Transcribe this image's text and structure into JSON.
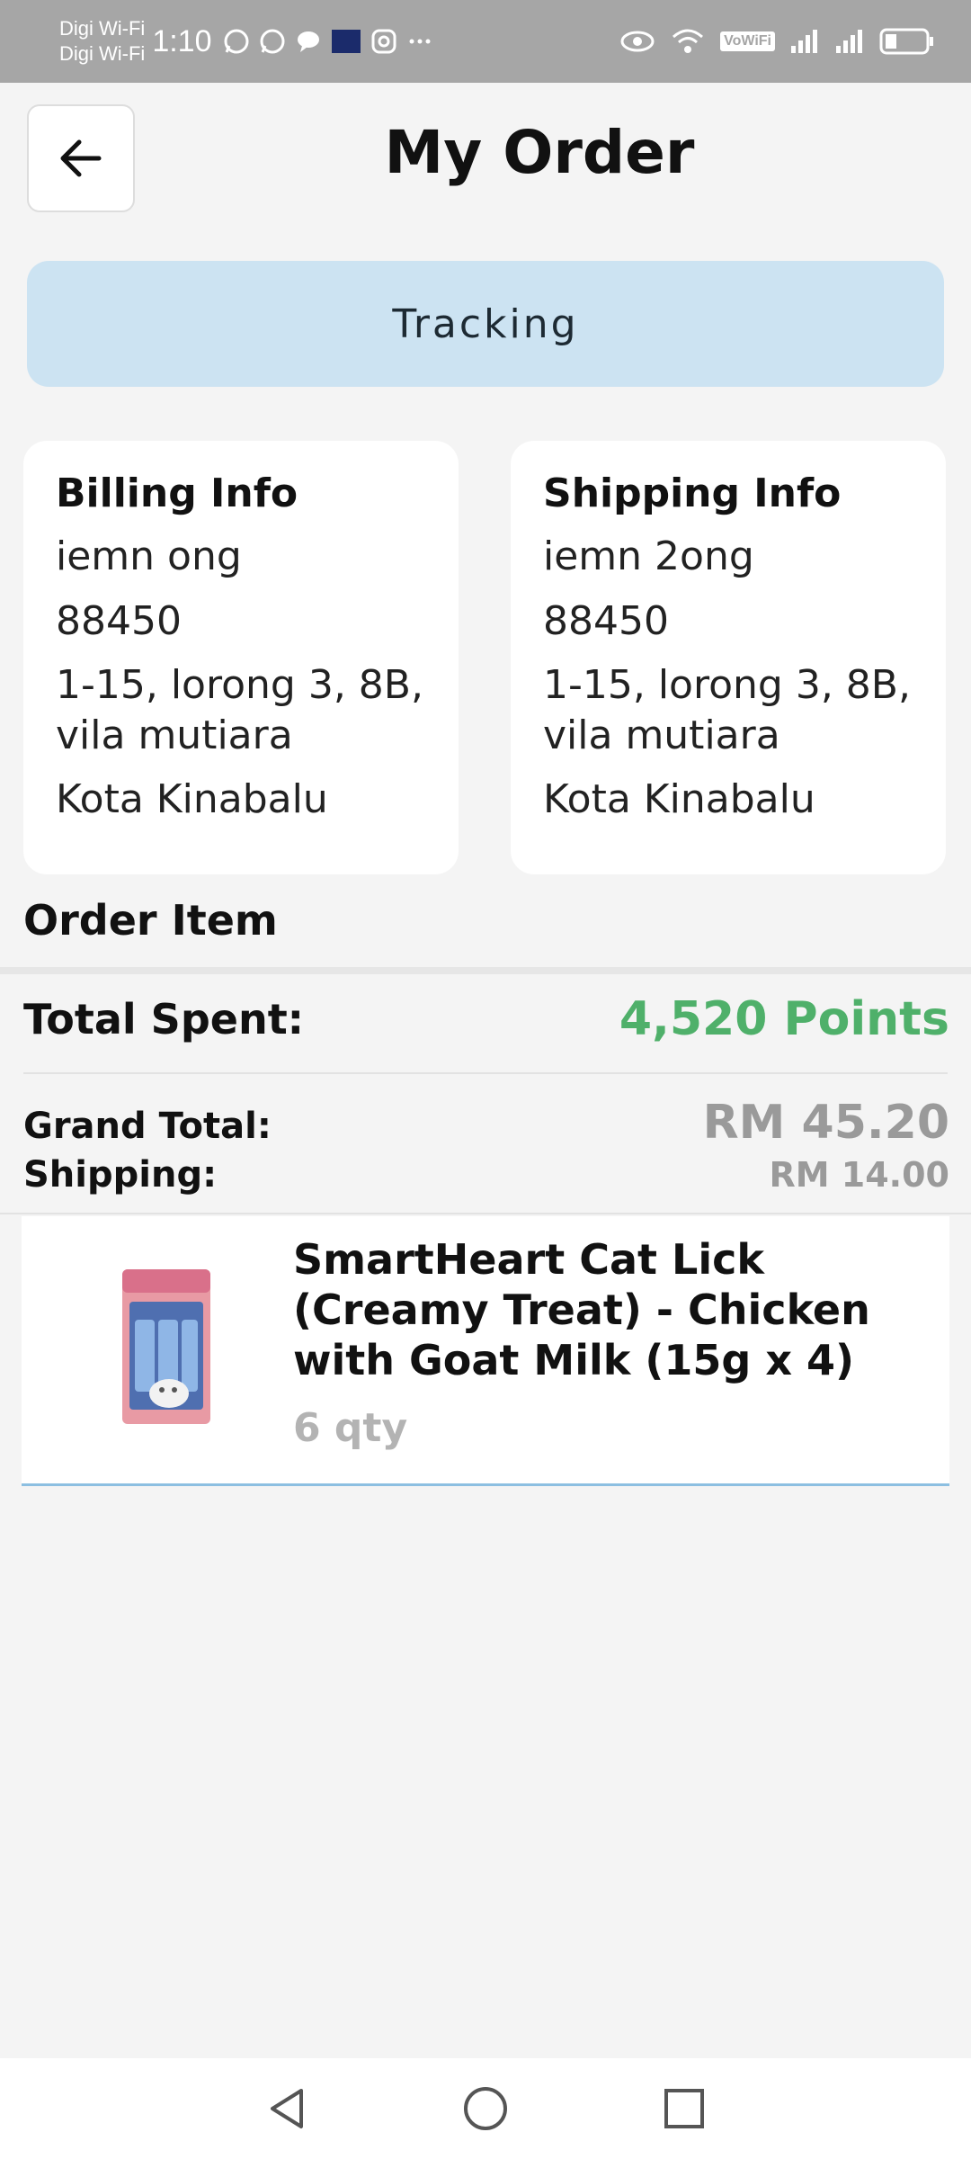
{
  "status_bar": {
    "carrier_1": "Digi Wi-Fi",
    "carrier_2": "Digi Wi-Fi",
    "time": "1:10",
    "vowifi": "VoWiFi"
  },
  "header": {
    "title": "My Order"
  },
  "tracking": {
    "label": "Tracking"
  },
  "billing": {
    "title": "Billing Info",
    "name": "iemn ong",
    "postcode": "88450",
    "address": "1-15, lorong 3, 8B, vila mutiara",
    "city": "Kota Kinabalu"
  },
  "shipping": {
    "title": "Shipping Info",
    "name": "iemn 2ong",
    "postcode": "88450",
    "address": "1-15, lorong 3, 8B, vila mutiara",
    "city": "Kota Kinabalu"
  },
  "order": {
    "section_title": "Order Item",
    "total_spent_label": "Total Spent:",
    "total_spent_value": "4,520 Points",
    "grand_total_label": "Grand Total:",
    "grand_total_value": "RM 45.20",
    "shipping_label": "Shipping:",
    "shipping_value": "RM 14.00",
    "items": [
      {
        "name": "SmartHeart Cat Lick (Creamy Treat) - Chicken with Goat Milk (15g x 4)",
        "qty": "6 qty"
      }
    ]
  },
  "colors": {
    "points_green": "#4fb06a",
    "tracking_bg": "#cce3f2",
    "muted_gray": "#9a9a9a",
    "item_border": "#8cbfe1"
  },
  "icons": {
    "back": "arrow-left-icon",
    "nav_back": "triangle-back-icon",
    "nav_home": "circle-home-icon",
    "nav_recents": "square-recents-icon"
  }
}
